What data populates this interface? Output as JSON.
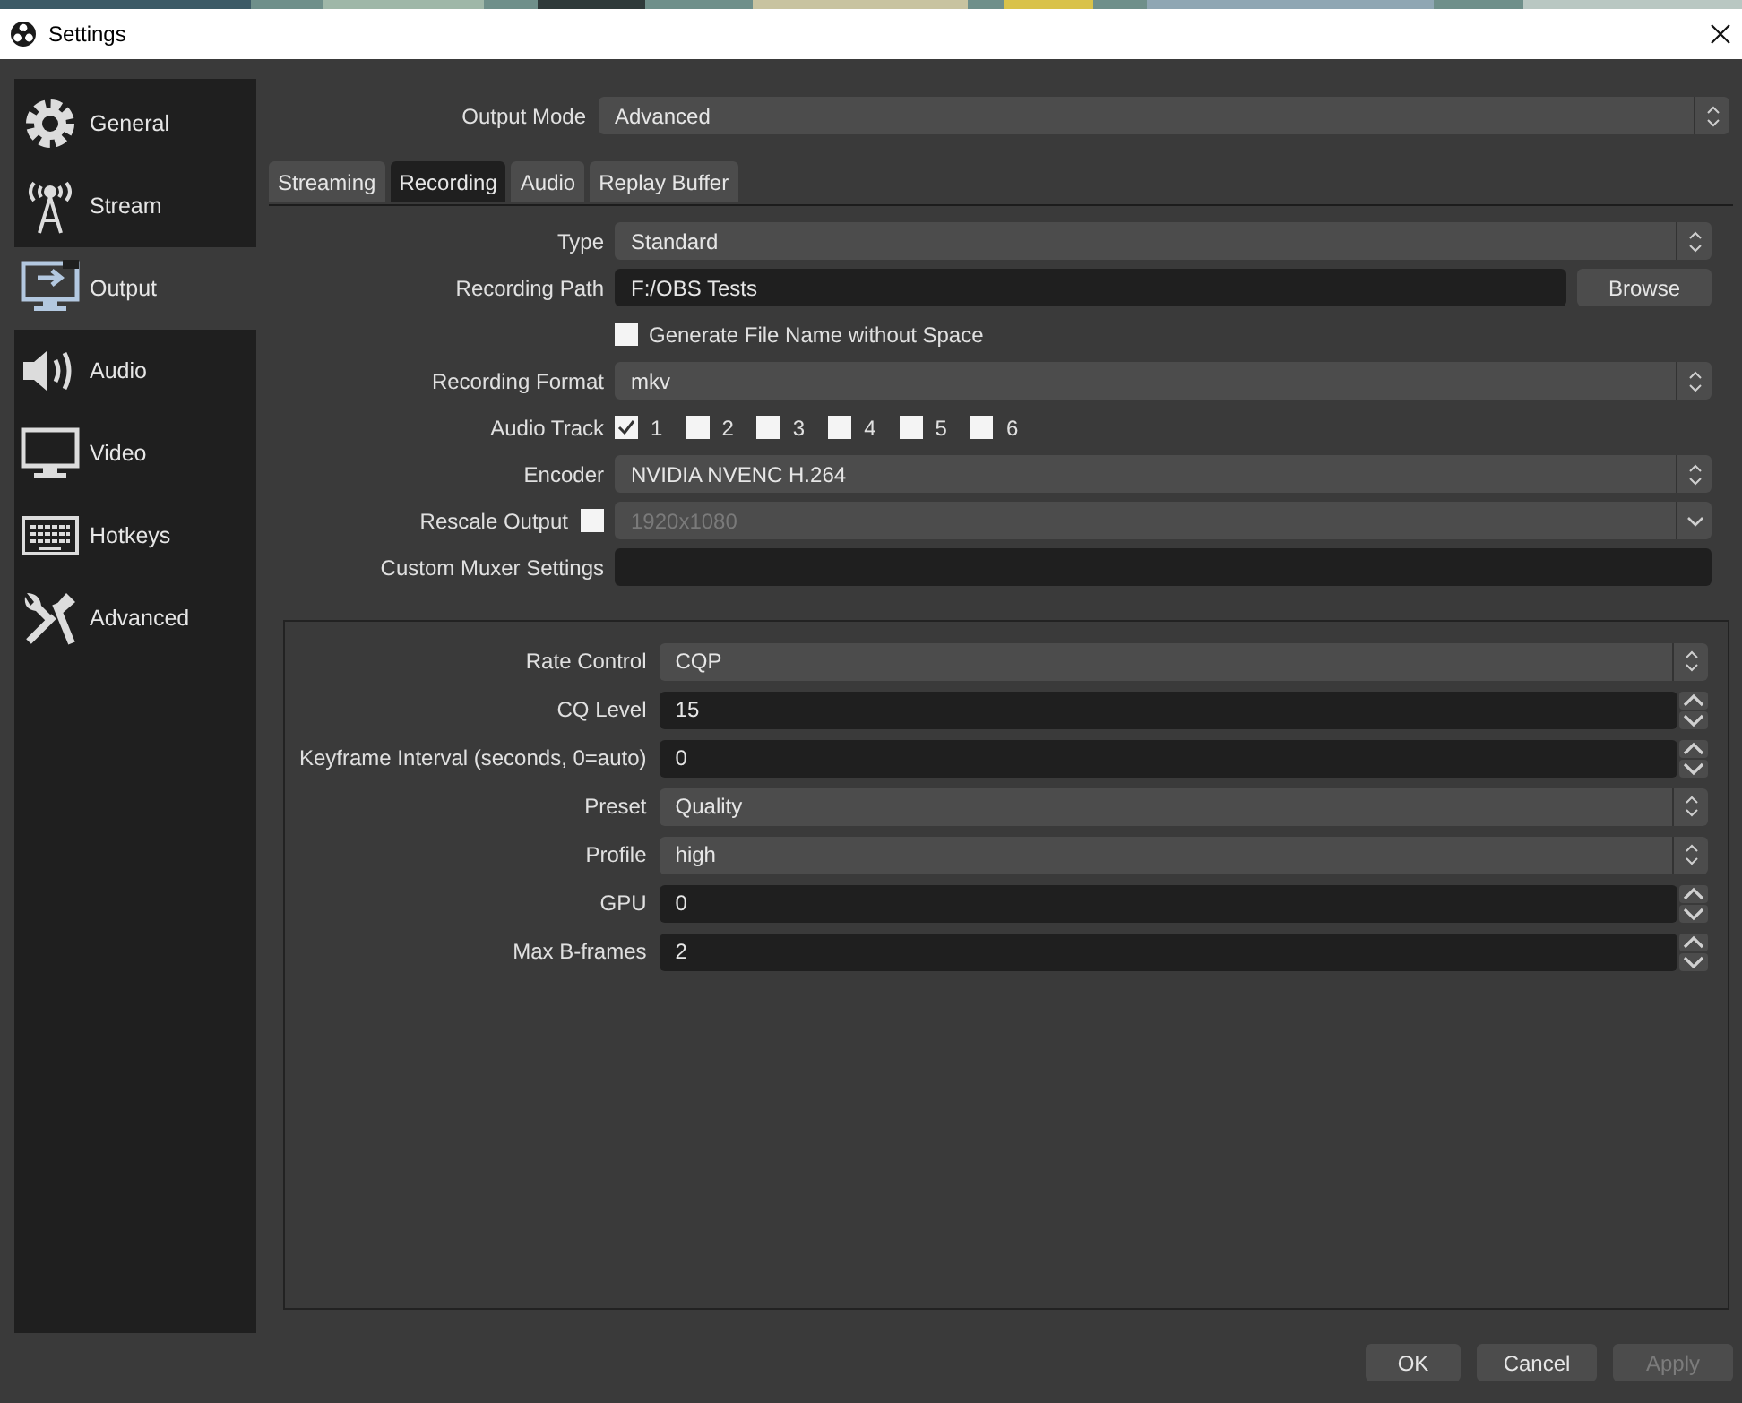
{
  "window": {
    "title": "Settings"
  },
  "sidebar": {
    "items": [
      {
        "label": "General",
        "selected": false
      },
      {
        "label": "Stream",
        "selected": false
      },
      {
        "label": "Output",
        "selected": true
      },
      {
        "label": "Audio",
        "selected": false
      },
      {
        "label": "Video",
        "selected": false
      },
      {
        "label": "Hotkeys",
        "selected": false
      },
      {
        "label": "Advanced",
        "selected": false
      }
    ]
  },
  "output_mode": {
    "label": "Output Mode",
    "value": "Advanced"
  },
  "tabs": [
    {
      "label": "Streaming",
      "selected": false
    },
    {
      "label": "Recording",
      "selected": true
    },
    {
      "label": "Audio",
      "selected": false
    },
    {
      "label": "Replay Buffer",
      "selected": false
    }
  ],
  "recording": {
    "fields": [
      {
        "kind": "combo",
        "label": "Type",
        "value": "Standard"
      },
      {
        "kind": "path",
        "label": "Recording Path",
        "value": "F:/OBS Tests",
        "button": "Browse"
      },
      {
        "kind": "checkbox",
        "label": "Generate File Name without Space",
        "checked": false
      },
      {
        "kind": "combo",
        "label": "Recording Format",
        "value": "mkv"
      },
      {
        "kind": "tracks",
        "label": "Audio Track",
        "tracks": [
          {
            "label": "1",
            "checked": true
          },
          {
            "label": "2",
            "checked": false
          },
          {
            "label": "3",
            "checked": false
          },
          {
            "label": "4",
            "checked": false
          },
          {
            "label": "5",
            "checked": false
          },
          {
            "label": "6",
            "checked": false
          }
        ]
      },
      {
        "kind": "combo",
        "label": "Encoder",
        "value": "NVIDIA NVENC H.264"
      },
      {
        "kind": "rescale",
        "label": "Rescale Output",
        "checked": false,
        "value": "1920x1080",
        "disabled": true
      },
      {
        "kind": "text",
        "label": "Custom Muxer Settings"
      }
    ]
  },
  "encoder_settings": {
    "fields": [
      {
        "kind": "combo",
        "label": "Rate Control",
        "value": "CQP"
      },
      {
        "kind": "spin",
        "label": "CQ Level",
        "value": "15"
      },
      {
        "kind": "spin",
        "label": "Keyframe Interval (seconds, 0=auto)",
        "value": "0"
      },
      {
        "kind": "combo",
        "label": "Preset",
        "value": "Quality"
      },
      {
        "kind": "combo",
        "label": "Profile",
        "value": "high"
      },
      {
        "kind": "spin",
        "label": "GPU",
        "value": "0"
      },
      {
        "kind": "spin",
        "label": "Max B-frames",
        "value": "2"
      }
    ]
  },
  "buttons": [
    {
      "label": "OK",
      "disabled": false
    },
    {
      "label": "Cancel",
      "disabled": false
    },
    {
      "label": "Apply",
      "disabled": true
    }
  ]
}
